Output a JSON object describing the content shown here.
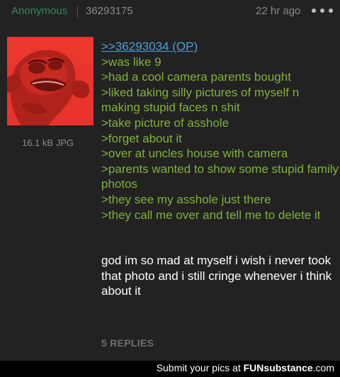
{
  "header": {
    "name": "Anonymous",
    "post_id": "36293175",
    "time": "22 hr ago",
    "more_icon": "more-horizontal-icon"
  },
  "image": {
    "file_meta": "16.1 kB JPG",
    "description_icon": "frog-meme-image"
  },
  "post": {
    "quote_link": ">>36293034 (OP)",
    "greentext": [
      ">was like 9",
      ">had a cool camera parents bought",
      ">liked taking silly pictures of myself n making stupid faces n shit",
      ">take picture of asshole",
      ">forget about it",
      ">over at uncles house with camera",
      ">parents wanted to show some stupid family photos",
      ">they see my asshole just there",
      ">they call me over and tell me to delete it"
    ],
    "body": "god im so mad at myself i wish i never took that photo and i still cringe whenever i think about it",
    "replies_label": "5 REPLIES"
  },
  "footer": {
    "prefix": "Submit your pics at ",
    "brand_fun": "FUN",
    "brand_sub": "substance",
    "brand_tld": ".com"
  },
  "colors": {
    "background": "#222222",
    "greentext": "#7fb23a",
    "quote_link": "#4aa0d5",
    "name": "#2f8b54"
  }
}
